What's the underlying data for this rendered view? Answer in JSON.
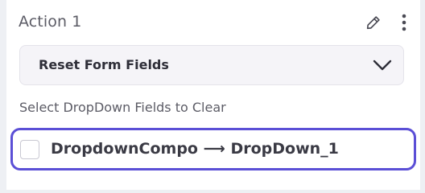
{
  "action": {
    "title": "Action 1",
    "edit_icon": "pencil-icon",
    "more_icon": "more-vertical-icon"
  },
  "action_type_select": {
    "value": "Reset Form Fields",
    "icon": "chevron-down-icon"
  },
  "fields": {
    "label": "Select DropDown Fields to Clear",
    "options": [
      {
        "label": "DropdownCompo ⟶ DropDown_1",
        "checked": false
      }
    ]
  },
  "colors": {
    "accent": "#5b4fd6",
    "text_primary": "#2e2e38",
    "text_secondary": "#5c5c66",
    "select_bg": "#f5f4f8"
  }
}
